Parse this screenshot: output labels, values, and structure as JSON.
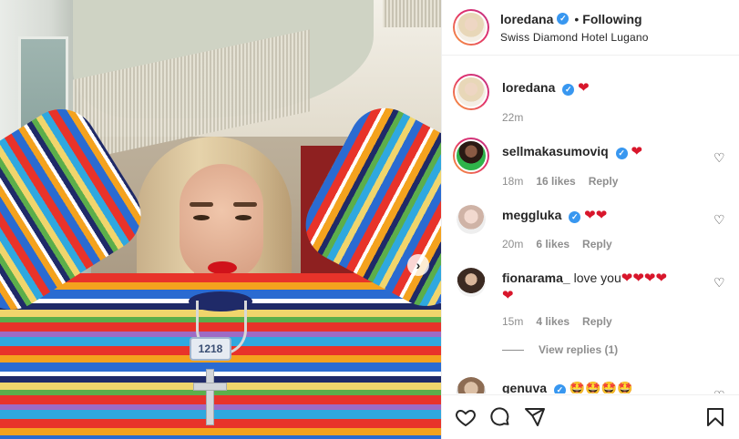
{
  "post": {
    "author": "loredana",
    "following_label": "Following",
    "location": "Swiss Diamond Hotel Lugano",
    "photo_tag": "1218"
  },
  "caption": {
    "username": "loredana",
    "text": "❤",
    "time": "22m"
  },
  "comments": [
    {
      "username": "sellmakasumoviq",
      "text": "❤",
      "time": "18m",
      "likes": "16 likes",
      "reply": "Reply"
    },
    {
      "username": "meggluka",
      "text": "❤❤",
      "time": "20m",
      "likes": "6 likes",
      "reply": "Reply"
    },
    {
      "username": "fionarama_",
      "text": "love you",
      "hearts": "❤❤❤❤",
      "hearts2": "❤",
      "time": "15m",
      "likes": "4 likes",
      "reply": "Reply"
    },
    {
      "username": "genuva",
      "text": "🤩🤩🤩🤩"
    }
  ],
  "view_replies": "View replies (1)",
  "colors": {
    "verified": "#3897f0",
    "heart": "#d8162b",
    "ring_start": "#f9a03a",
    "ring_end": "#c13584"
  },
  "icons": {
    "like": "heart-outline-icon",
    "comment": "comment-icon",
    "share": "paper-plane-icon",
    "save": "bookmark-icon",
    "next": "chevron-right-icon"
  }
}
